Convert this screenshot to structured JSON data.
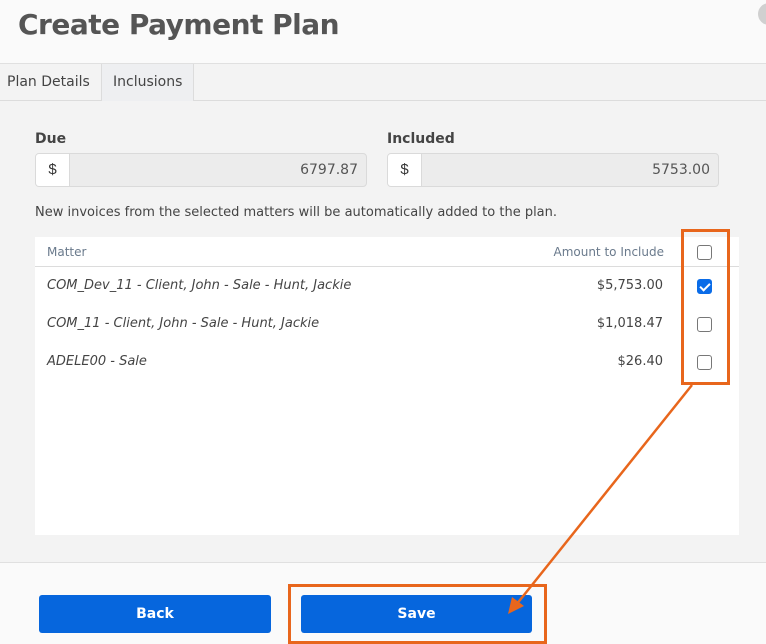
{
  "header": {
    "title": "Create Payment Plan"
  },
  "tabs": [
    {
      "label": "Plan Details",
      "active": false
    },
    {
      "label": "Inclusions",
      "active": true
    }
  ],
  "fields": {
    "due": {
      "label": "Due",
      "prefix": "$",
      "value": "6797.87"
    },
    "included": {
      "label": "Included",
      "prefix": "$",
      "value": "5753.00"
    }
  },
  "note": "New invoices from the selected matters will be automatically added to the plan.",
  "table": {
    "columns": {
      "matter": "Matter",
      "amount": "Amount to Include"
    },
    "select_all_checked": false,
    "rows": [
      {
        "matter": "COM_Dev_11 - Client, John - Sale - Hunt, Jackie",
        "amount": "$5,753.00",
        "checked": true
      },
      {
        "matter": "COM_11 - Client, John - Sale - Hunt, Jackie",
        "amount": "$1,018.47",
        "checked": false
      },
      {
        "matter": "ADELE00 - Sale",
        "amount": "$26.40",
        "checked": false
      }
    ]
  },
  "footer": {
    "back_label": "Back",
    "save_label": "Save"
  },
  "annotation": {
    "color": "#e8661c"
  }
}
